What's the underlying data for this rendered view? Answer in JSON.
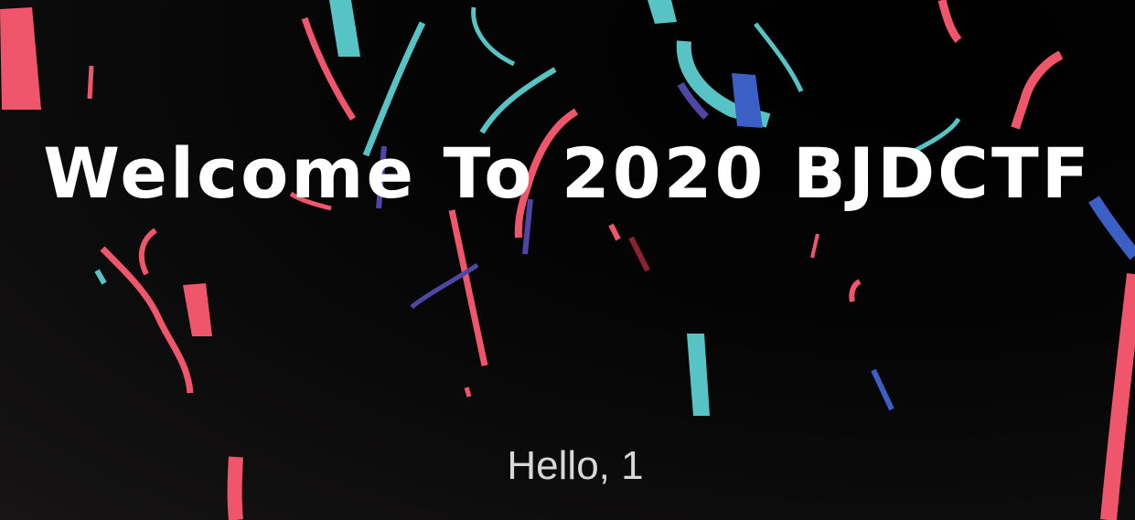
{
  "title": "Welcome To 2020 BJDCTF",
  "greeting": "Hello, 1",
  "confetti_colors": {
    "coral": "#f0566b",
    "teal": "#57c3c4",
    "royal_blue": "#3b5fc4",
    "indigo": "#4f46a6",
    "dark_red": "#8b2332"
  }
}
